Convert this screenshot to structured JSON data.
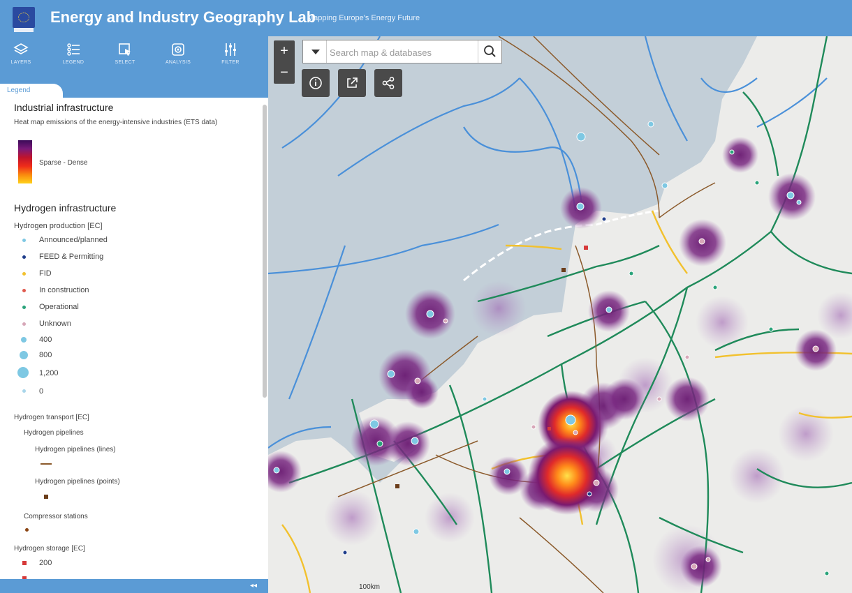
{
  "header": {
    "title": "Energy and Industry Geography Lab",
    "subtitle": "Mapping Europe's Energy Future"
  },
  "toolbar": {
    "layers": "LAYERS",
    "legend": "LEGEND",
    "select": "SELECT",
    "analysis": "ANALYSIS",
    "filter": "FILTER"
  },
  "tabs": {
    "legend": "Legend"
  },
  "legend": {
    "industrial": {
      "title": "Industrial infrastructure",
      "heatmap_label": "Heat map emissions of the energy-intensive industries (ETS data)",
      "gradient_label": "Sparse - Dense"
    },
    "hydrogen": {
      "title": "Hydrogen infrastructure",
      "production_title": "Hydrogen production [EC]",
      "status_items": [
        {
          "label": "Announced/planned",
          "color": "#7ec8e3"
        },
        {
          "label": "FEED & Permitting",
          "color": "#1f3d8a"
        },
        {
          "label": "FID",
          "color": "#f2c12e"
        },
        {
          "label": "In construction",
          "color": "#e05a4e"
        },
        {
          "label": "Operational",
          "color": "#2aa37a"
        },
        {
          "label": "Unknown",
          "color": "#d7a7b8"
        }
      ],
      "size_items": [
        "400",
        "800",
        "1,200",
        "0"
      ],
      "transport_title": "Hydrogen transport [EC]",
      "pipelines_title": "Hydrogen pipelines",
      "pipelines_lines": "Hydrogen pipelines (lines)",
      "pipelines_points": "Hydrogen pipelines (points)",
      "compressor": "Compressor stations",
      "storage_title": "Hydrogen storage [EC]",
      "storage_value": "200"
    }
  },
  "map": {
    "search_placeholder": "Search map & databases",
    "zoom_in": "+",
    "zoom_out": "−",
    "scale_label": "100km"
  },
  "colors": {
    "brand": "#5b9bd5",
    "water": "#c3cfd8",
    "land": "#ececea",
    "gas_network": "#1f8a5a",
    "offshore": "#4a90d9",
    "pipeline_h2": "#8b5a2b",
    "fid_line": "#f2c12e"
  }
}
